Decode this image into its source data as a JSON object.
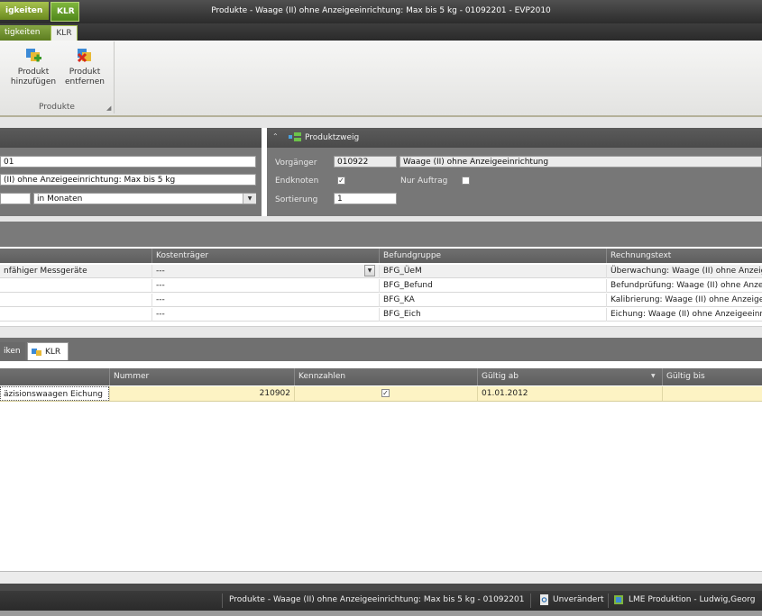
{
  "window": {
    "title": "Produkte - Waage (II) ohne Anzeigeeinrichtung: Max bis 5 kg - 01092201 - EVP2010",
    "context_tabs": [
      "igkeiten",
      "KLR"
    ]
  },
  "ribbon": {
    "tabs": [
      "tigkeiten",
      "KLR"
    ],
    "buttons": {
      "add": "Produkt hinzufügen",
      "remove": "Produkt entfernen"
    },
    "group_label": "Produkte"
  },
  "left_panel": {
    "code_value": "01",
    "name_value": "(II) ohne Anzeigeeinrichtung: Max bis 5 kg",
    "period_value": "",
    "period_unit": "in Monaten"
  },
  "right_panel": {
    "title": "Produktzweig",
    "vorgaenger_label": "Vorgänger",
    "vorgaenger_code": "010922",
    "vorgaenger_name": "Waage (II) ohne Anzeigeeinrichtung",
    "endknoten_label": "Endknoten",
    "endknoten_checked": true,
    "nur_auftrag_label": "Nur Auftrag",
    "nur_auftrag_checked": false,
    "sortierung_label": "Sortierung",
    "sortierung_value": "1"
  },
  "grid1": {
    "columns": [
      "",
      "Kostenträger",
      "Befundgruppe",
      "Rechnungstext"
    ],
    "rows": [
      {
        "c0": "nfähiger Messgeräte",
        "c1": "---",
        "c2": "BFG_ÜeM",
        "c3": "Überwachung: Waage (II) ohne Anzeig"
      },
      {
        "c0": "",
        "c1": "---",
        "c2": "BFG_Befund",
        "c3": "Befundprüfung: Waage (II) ohne Anze"
      },
      {
        "c0": "",
        "c1": "---",
        "c2": "BFG_KA",
        "c3": "Kalibrierung: Waage (II) ohne Anzeige"
      },
      {
        "c0": "",
        "c1": "---",
        "c2": "BFG_Eich",
        "c3": "Eichung: Waage (II) ohne Anzeigeeinr"
      }
    ]
  },
  "lower_tabs": [
    "iken",
    "KLR"
  ],
  "grid2": {
    "columns": [
      "",
      "Nummer",
      "Kennzahlen",
      "Gültig ab",
      "Gültig bis"
    ],
    "row": {
      "name": "äzisionswaagen Eichung",
      "nummer": "210902",
      "kennzahlen_checked": true,
      "gueltig_ab": "01.01.2012",
      "gueltig_bis": ""
    }
  },
  "status": {
    "item1": "Produkte - Waage (II) ohne Anzeigeeinrichtung: Max bis 5 kg - 01092201",
    "item2": "Unverändert",
    "item3": "LME Produktion - Ludwig,Georg"
  },
  "colors": {
    "accent_green": "#6b8a1f",
    "row_highlight": "#fdf3c4"
  }
}
